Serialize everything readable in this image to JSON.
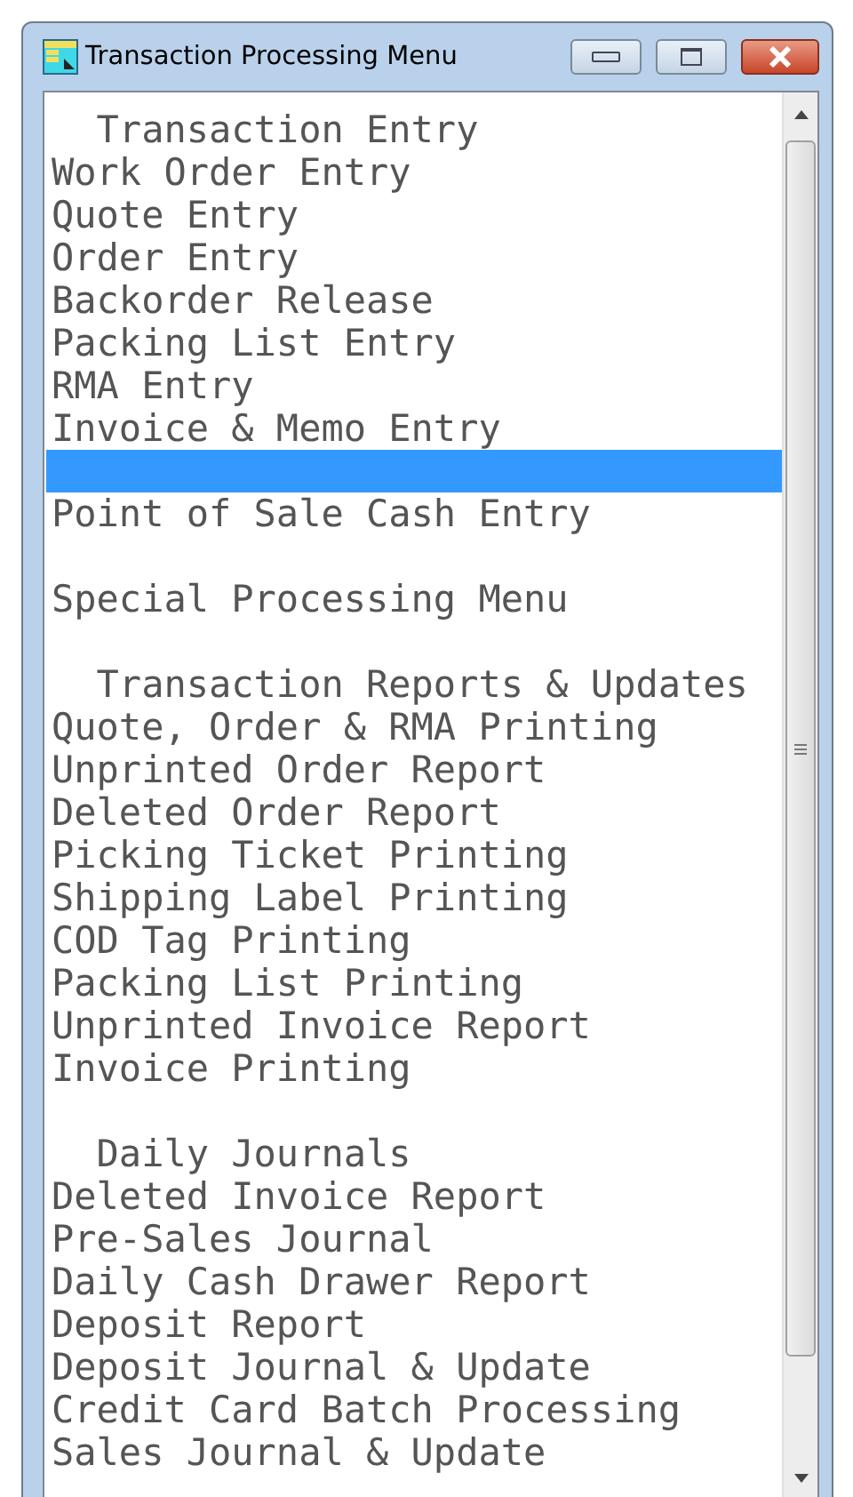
{
  "window": {
    "title": "Transaction Processing Menu"
  },
  "menu": [
    {
      "kind": "heading",
      "label": "Transaction Entry"
    },
    {
      "kind": "item",
      "label": "Work Order Entry",
      "selected": false
    },
    {
      "kind": "item",
      "label": "Quote Entry",
      "selected": false
    },
    {
      "kind": "item",
      "label": "Order Entry",
      "selected": false
    },
    {
      "kind": "item",
      "label": "Backorder Release",
      "selected": false
    },
    {
      "kind": "item",
      "label": "Packing List Entry",
      "selected": false
    },
    {
      "kind": "item",
      "label": "RMA Entry",
      "selected": false
    },
    {
      "kind": "item",
      "label": "Invoice & Memo Entry",
      "selected": false
    },
    {
      "kind": "blank",
      "selected": true
    },
    {
      "kind": "item",
      "label": "Point of Sale Cash Entry",
      "selected": false
    },
    {
      "kind": "blank"
    },
    {
      "kind": "item",
      "label": "Special Processing Menu",
      "selected": false
    },
    {
      "kind": "blank"
    },
    {
      "kind": "heading",
      "label": "Transaction Reports & Updates"
    },
    {
      "kind": "item",
      "label": "Quote, Order & RMA Printing",
      "selected": false
    },
    {
      "kind": "item",
      "label": "Unprinted Order Report",
      "selected": false
    },
    {
      "kind": "item",
      "label": "Deleted Order Report",
      "selected": false
    },
    {
      "kind": "item",
      "label": "Picking Ticket Printing",
      "selected": false
    },
    {
      "kind": "item",
      "label": "Shipping Label Printing",
      "selected": false
    },
    {
      "kind": "item",
      "label": "COD Tag Printing",
      "selected": false
    },
    {
      "kind": "item",
      "label": "Packing List Printing",
      "selected": false
    },
    {
      "kind": "item",
      "label": "Unprinted Invoice Report",
      "selected": false
    },
    {
      "kind": "item",
      "label": "Invoice Printing",
      "selected": false
    },
    {
      "kind": "blank"
    },
    {
      "kind": "heading",
      "label": "Daily Journals"
    },
    {
      "kind": "item",
      "label": "Deleted Invoice Report",
      "selected": false
    },
    {
      "kind": "item",
      "label": "Pre-Sales Journal",
      "selected": false
    },
    {
      "kind": "item",
      "label": "Daily Cash Drawer Report",
      "selected": false
    },
    {
      "kind": "item",
      "label": "Deposit Report",
      "selected": false
    },
    {
      "kind": "item",
      "label": "Deposit Journal & Update",
      "selected": false
    },
    {
      "kind": "item",
      "label": "Credit Card Batch Processing",
      "selected": false
    },
    {
      "kind": "item",
      "label": "Sales Journal & Update",
      "selected": false
    }
  ]
}
